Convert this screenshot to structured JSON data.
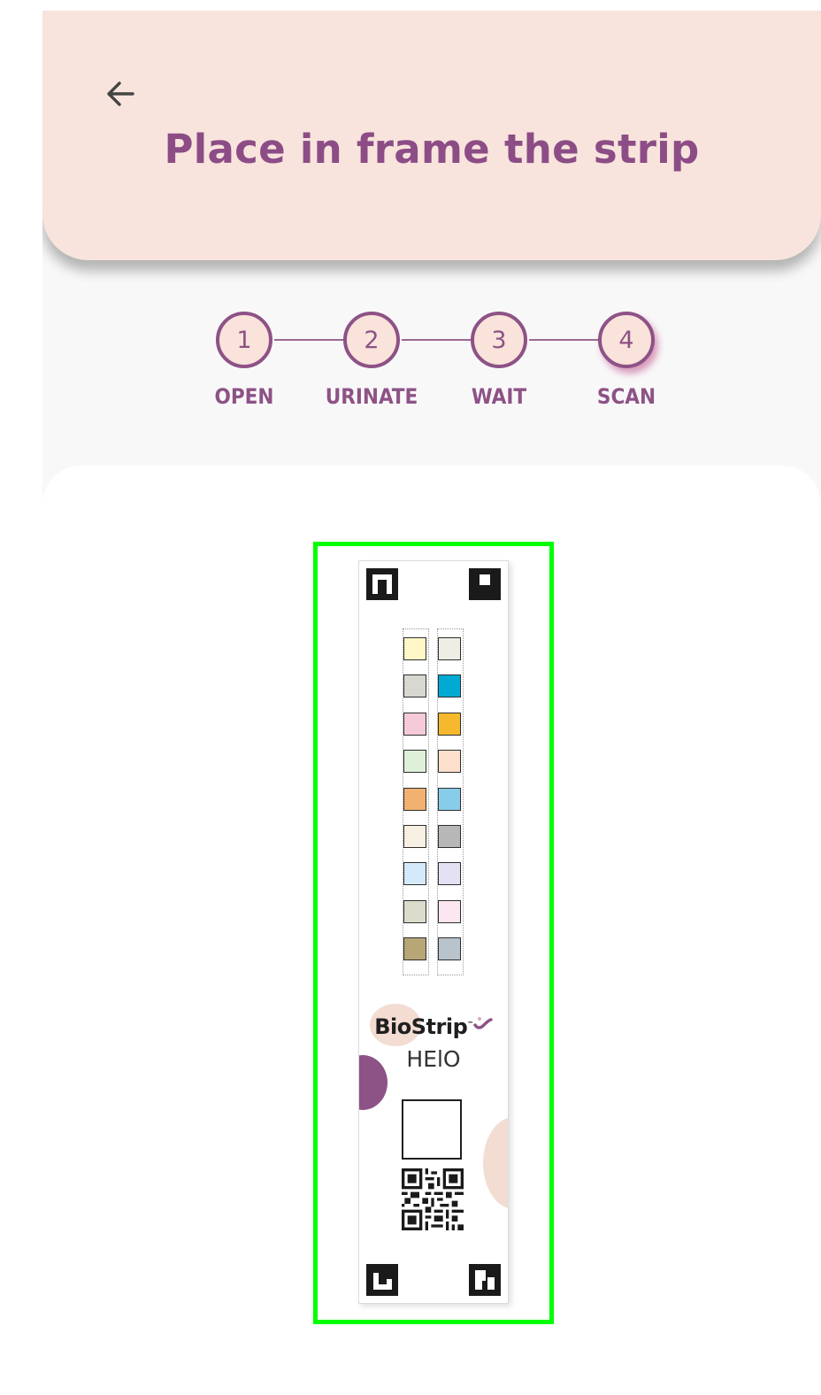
{
  "header": {
    "back_icon": "arrow-left-icon",
    "title": "Place in frame the strip",
    "background": "#f8e4dc",
    "title_color": "#8c4d86"
  },
  "steps": [
    {
      "number": "1",
      "label": "OPEN",
      "active": false
    },
    {
      "number": "2",
      "label": "URINATE",
      "active": false
    },
    {
      "number": "3",
      "label": "WAIT",
      "active": false
    },
    {
      "number": "4",
      "label": "SCAN",
      "active": true
    }
  ],
  "scanner": {
    "frame_color": "#00ff00",
    "strip": {
      "brand": "BioStrip",
      "trademark": "™",
      "sub_brand": "HElO",
      "pads_left": [
        "#fff8c6",
        "#d9d8d0",
        "#f7cad9",
        "#dff0da",
        "#f2b170",
        "#f7efe1",
        "#d4e9fa",
        "#dcdccc",
        "#b7a676"
      ],
      "pads_right": [
        "#eeeee4",
        "#00aad3",
        "#f6b92e",
        "#fde0cc",
        "#87cdea",
        "#b7b7b7",
        "#e3e1f3",
        "#fbe6f1",
        "#b8c3cc"
      ]
    }
  }
}
